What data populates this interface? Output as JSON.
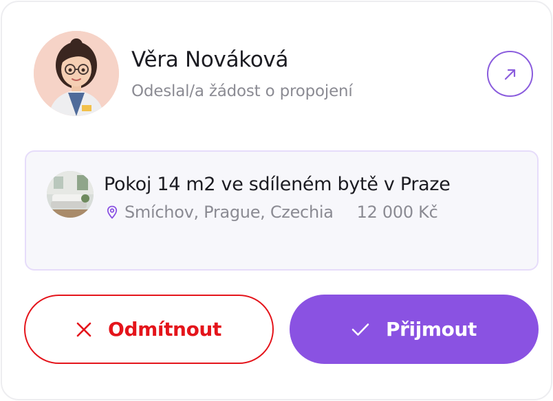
{
  "sender": {
    "name": "Věra Nováková",
    "subtitle": "Odeslal/a žádost o propojení"
  },
  "listing": {
    "title": "Pokoj 14 m2 ve sdíleném bytě v Praze",
    "location": "Smíchov, Prague, Czechia",
    "price": "12 000 Kč"
  },
  "actions": {
    "reject_label": "Odmítnout",
    "accept_label": "Přijmout"
  },
  "colors": {
    "accent": "#8a52e2",
    "danger": "#e4141b"
  },
  "icons": {
    "open": "arrow-up-right-icon",
    "location": "map-pin-icon",
    "reject": "close-icon",
    "accept": "check-icon"
  }
}
